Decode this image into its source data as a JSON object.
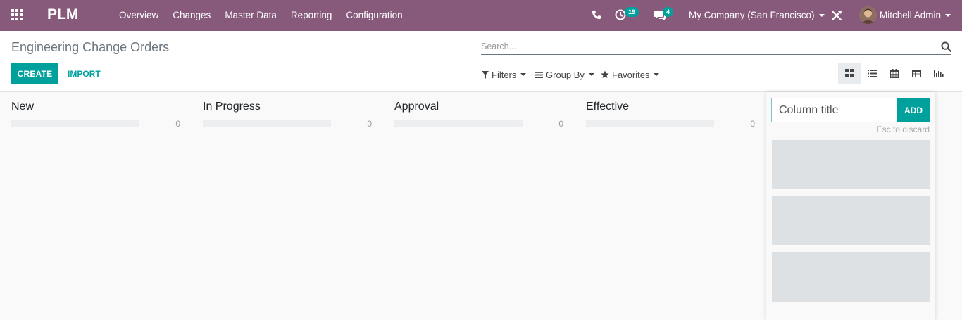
{
  "navbar": {
    "app_name": "PLM",
    "menu": [
      "Overview",
      "Changes",
      "Master Data",
      "Reporting",
      "Configuration"
    ],
    "activity_count": "19",
    "message_count": "4",
    "company": "My Company (San Francisco)",
    "user": "Mitchell Admin",
    "bg_color": "#875a7b"
  },
  "control_panel": {
    "title": "Engineering Change Orders",
    "search_placeholder": "Search...",
    "create_label": "CREATE",
    "import_label": "IMPORT",
    "filters_label": "Filters",
    "groupby_label": "Group By",
    "favorites_label": "Favorites",
    "views": [
      "kanban",
      "list",
      "calendar",
      "pivot",
      "graph"
    ],
    "active_view": "kanban"
  },
  "kanban": {
    "columns": [
      {
        "title": "New",
        "count": "0"
      },
      {
        "title": "In Progress",
        "count": "0"
      },
      {
        "title": "Approval",
        "count": "0"
      },
      {
        "title": "Effective",
        "count": "0"
      }
    ],
    "quick_create": {
      "placeholder": "Column title",
      "add_label": "ADD",
      "hint": "Esc to discard"
    }
  },
  "colors": {
    "accent": "#00a09d"
  }
}
